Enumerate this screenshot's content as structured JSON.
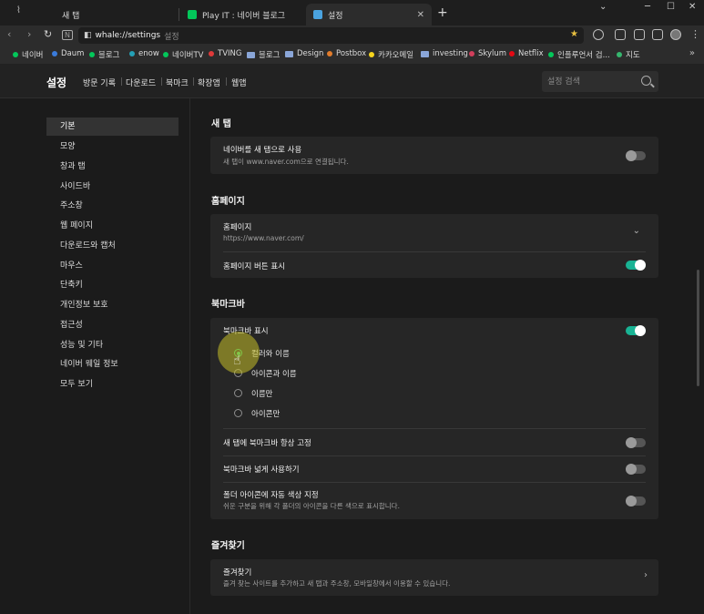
{
  "tabs": [
    {
      "label": "새 탭"
    },
    {
      "label": "Play IT : 네이버 블로그"
    },
    {
      "label": "설정"
    }
  ],
  "toolbar": {
    "url": "whale://settings",
    "url_suffix": "설정"
  },
  "bookmarks": [
    {
      "label": "네이버",
      "color": "#03c75a"
    },
    {
      "label": "Daum",
      "color": "#3a7bdb"
    },
    {
      "label": "블로그",
      "color": "#03c75a"
    },
    {
      "label": "enow",
      "color": "#24a0b6"
    },
    {
      "label": "네이버TV",
      "color": "#03c75a"
    },
    {
      "label": "TVING",
      "color": "#e03a3a"
    },
    {
      "label": "블로그",
      "folder": true
    },
    {
      "label": "Design",
      "folder": true
    },
    {
      "label": "Postbox",
      "color": "#e27c2b"
    },
    {
      "label": "카카오메일",
      "color": "#f7d51d"
    },
    {
      "label": "investing",
      "folder": true
    },
    {
      "label": "Skylum",
      "color": "#d23f5c"
    },
    {
      "label": "Netflix",
      "color": "#e50914"
    },
    {
      "label": "인플루언서 검...",
      "color": "#03c75a"
    },
    {
      "label": "지도",
      "color": "#36b66e"
    }
  ],
  "header": {
    "title": "설정",
    "nav": [
      "방문 기록",
      "다운로드",
      "북마크",
      "확장앱",
      "웹앱"
    ],
    "search_placeholder": "설정 검색"
  },
  "sidebar": {
    "items": [
      {
        "label": "기본"
      },
      {
        "label": "모양"
      },
      {
        "label": "창과 탭"
      },
      {
        "label": "사이드바"
      },
      {
        "label": "주소창"
      },
      {
        "label": "웹 페이지"
      },
      {
        "label": "다운로드와 캡처"
      },
      {
        "label": "마우스"
      },
      {
        "label": "단축키"
      },
      {
        "label": "개인정보 보호"
      },
      {
        "label": "접근성"
      },
      {
        "label": "성능 및 기타"
      },
      {
        "label": "네이버 웨일 정보"
      },
      {
        "label": "모두 보기"
      }
    ]
  },
  "sections": {
    "newtab": {
      "title": "새 탭",
      "row_title": "네이버를 새 탭으로 사용",
      "row_desc": "새 탭이 www.naver.com으로 연결됩니다.",
      "enabled": false
    },
    "homepage": {
      "title": "홈페이지",
      "row1_title": "홈페이지",
      "row1_desc": "https://www.naver.com/",
      "row2_title": "홈페이지 버튼 표시",
      "row2_enabled": true
    },
    "bookmarkbar": {
      "title": "북마크바",
      "show_title": "북마크바 표시",
      "show_enabled": true,
      "options": [
        "컬러와 이름",
        "아이콘과 이름",
        "이름만",
        "아이콘만"
      ],
      "selected_option": "컬러와 이름",
      "pin_title": "새 탭에 북마크바 항상 고정",
      "pin_enabled": false,
      "wide_title": "북마크바 넓게 사용하기",
      "wide_enabled": false,
      "folder_title": "폴더 아이콘에 자동 색상 지정",
      "folder_desc": "쉬운 구분을 위해 각 폴더의 아이콘을 다른 색으로 표시합니다.",
      "folder_enabled": false
    },
    "favorites": {
      "title": "즐겨찾기",
      "row_title": "즐겨찾기",
      "row_desc": "즐겨 찾는 사이트를 추가하고 새 탭과 주소창, 모바일창에서 이용할 수 있습니다."
    }
  },
  "colors": {
    "accent_toggle": "#19b394",
    "radio_selected": "#2fcf6f"
  }
}
